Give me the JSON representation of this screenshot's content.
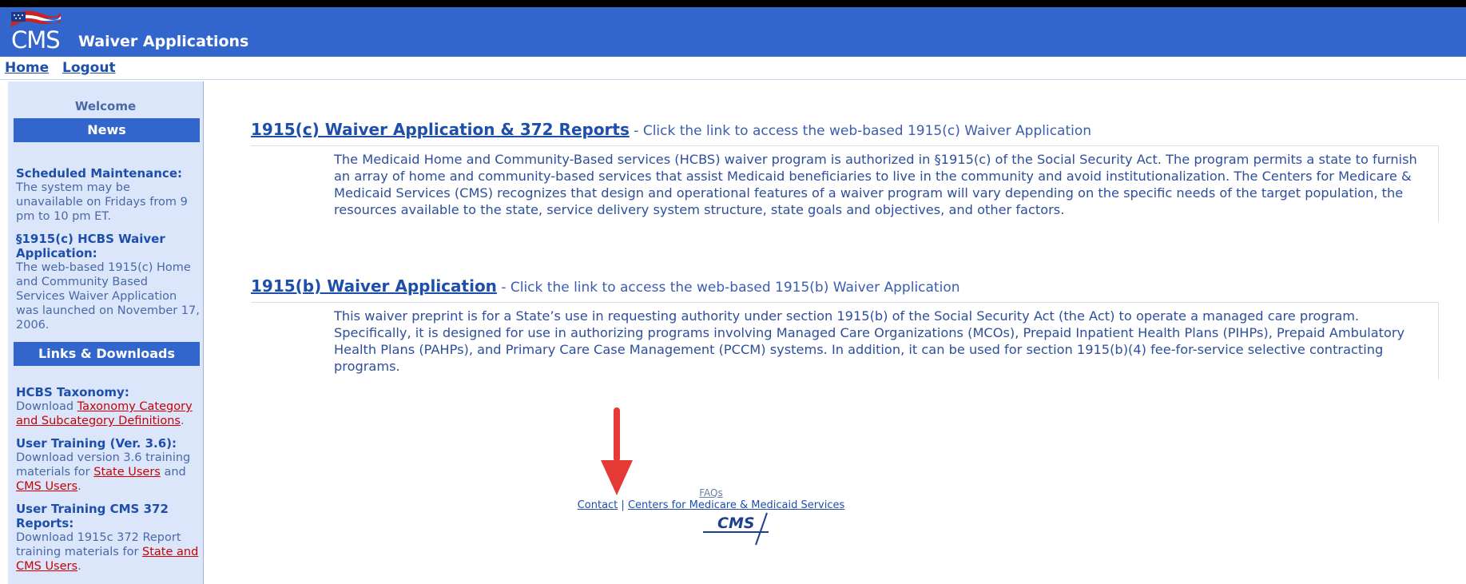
{
  "header": {
    "logo_text": "CMS",
    "app_title": "Waiver Applications"
  },
  "nav": {
    "home": "Home",
    "logout": "Logout"
  },
  "sidebar": {
    "welcome": "Welcome",
    "news_heading": "News",
    "news": [
      {
        "title": "Scheduled Maintenance:",
        "body": "The system may be unavailable on Fridays from 9 pm to 10 pm ET."
      },
      {
        "title": "§1915(c) HCBS Waiver Application:",
        "body": "The web-based 1915(c) Home and Community Based Services Waiver Application was launched on November 17, 2006."
      }
    ],
    "links_heading": "Links & Downloads",
    "links": [
      {
        "title": "HCBS Taxonomy:",
        "pre": "Download ",
        "link1": "Taxonomy Category and Subcategory Definitions",
        "mid": "",
        "link2": "",
        "post": "."
      },
      {
        "title": "User Training (Ver. 3.6):",
        "pre": "Download version 3.6 training materials for ",
        "link1": "State Users",
        "mid": " and ",
        "link2": "CMS Users",
        "post": "."
      },
      {
        "title": "User Training CMS 372 Reports:",
        "pre": "Download 1915c 372 Report training materials for ",
        "link1": "State and CMS Users",
        "mid": "",
        "link2": "",
        "post": "."
      }
    ]
  },
  "main": {
    "sections": [
      {
        "link": "1915(c) Waiver Application & 372 Reports",
        "suffix": " - Click the link to access the web-based 1915(c) Waiver Application",
        "description": "The Medicaid Home and Community-Based services (HCBS) waiver program is authorized in §1915(c) of the Social Security Act. The program permits a state to furnish an array of home and community-based services that assist Medicaid beneficiaries to live in the community and avoid institutionalization. The Centers for Medicare & Medicaid Services (CMS) recognizes that design and operational features of a waiver program will vary depending on the specific needs of the target population, the resources available to the state, service delivery system structure, state goals and objectives, and other factors."
      },
      {
        "link": "1915(b) Waiver Application",
        "suffix": " - Click the link to access the web-based 1915(b) Waiver Application",
        "description": "This waiver preprint is for a State’s use in requesting authority under section 1915(b) of the Social Security Act (the Act) to operate a managed care program. Specifically, it is designed for use in authorizing programs involving Managed Care Organizations (MCOs), Prepaid Inpatient Health Plans (PIHPs), Prepaid Ambulatory Health Plans (PAHPs), and Primary Care Case Management (PCCM) systems. In addition, it can be used for section 1915(b)(4) fee-for-service selective contracting programs."
      }
    ]
  },
  "footer": {
    "faqs": "FAQs",
    "contact": "Contact",
    "separator": "|",
    "cms_link": "Centers for Medicare & Medicaid Services",
    "logo_text": "CMS"
  },
  "colors": {
    "header_bg": "#3366cc",
    "sidebar_bg": "#dbe6fb",
    "link": "#1d4faa",
    "sidebar_link": "#cc0000",
    "annotation_arrow": "#e53935"
  },
  "icons": {
    "flag": "us-flag-icon",
    "arrow": "red-down-arrow-icon"
  }
}
